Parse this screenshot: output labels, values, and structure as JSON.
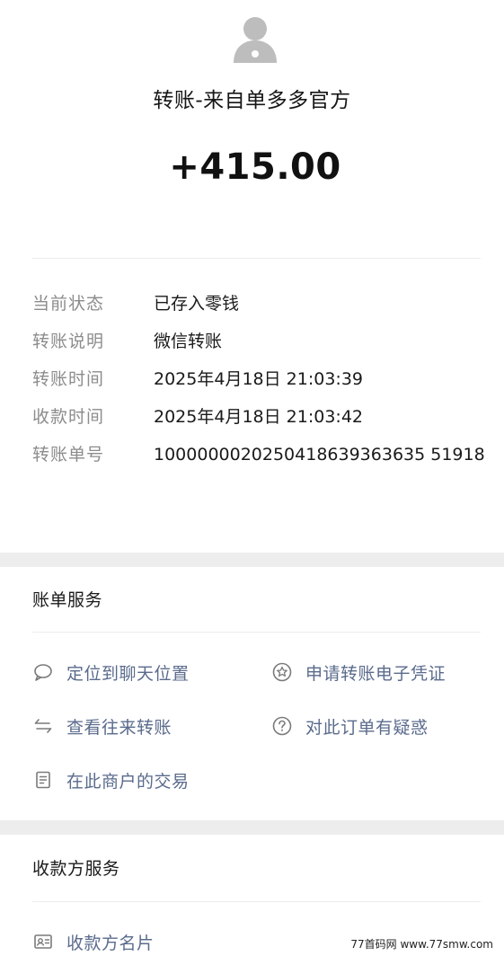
{
  "header": {
    "title": "转账-来自单多多官方",
    "amount": "+415.00"
  },
  "details": [
    {
      "label": "当前状态",
      "value": "已存入零钱"
    },
    {
      "label": "转账说明",
      "value": "微信转账"
    },
    {
      "label": "转账时间",
      "value": "2025年4月18日 21:03:39"
    },
    {
      "label": "收款时间",
      "value": "2025年4月18日 21:03:42"
    },
    {
      "label": "转账单号",
      "value": "1000000020250418639363635 51918"
    }
  ],
  "bill_services": {
    "title": "账单服务",
    "items": [
      {
        "label": "定位到聊天位置",
        "icon": "chat-bubble-icon"
      },
      {
        "label": "申请转账电子凭证",
        "icon": "star-badge-icon"
      },
      {
        "label": "查看往来转账",
        "icon": "swap-arrows-icon"
      },
      {
        "label": "对此订单有疑惑",
        "icon": "question-circle-icon"
      },
      {
        "label": "在此商户的交易",
        "icon": "receipt-icon"
      }
    ]
  },
  "payee_services": {
    "title": "收款方服务",
    "items": [
      {
        "label": "收款方名片",
        "icon": "contact-card-icon"
      }
    ]
  },
  "watermark": "77首码网 www.77smw.com",
  "colors": {
    "link": "#5a6b8c",
    "label_gray": "#8c8c8c",
    "gap_bg": "#ededed"
  }
}
